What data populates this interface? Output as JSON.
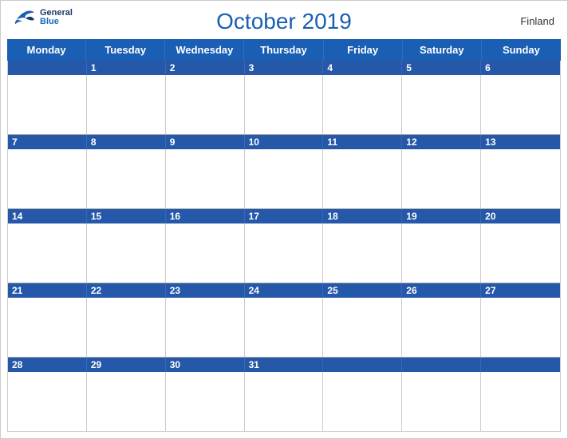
{
  "header": {
    "title": "October 2019",
    "country": "Finland",
    "logo": {
      "general": "General",
      "blue": "Blue"
    }
  },
  "dayHeaders": [
    "Monday",
    "Tuesday",
    "Wednesday",
    "Thursday",
    "Friday",
    "Saturday",
    "Sunday"
  ],
  "weeks": [
    {
      "numbers": [
        "",
        "1",
        "2",
        "3",
        "4",
        "5",
        "6"
      ]
    },
    {
      "numbers": [
        "7",
        "8",
        "9",
        "10",
        "11",
        "12",
        "13"
      ]
    },
    {
      "numbers": [
        "14",
        "15",
        "16",
        "17",
        "18",
        "19",
        "20"
      ]
    },
    {
      "numbers": [
        "21",
        "22",
        "23",
        "24",
        "25",
        "26",
        "27"
      ]
    },
    {
      "numbers": [
        "28",
        "29",
        "30",
        "31",
        "",
        "",
        ""
      ]
    }
  ],
  "colors": {
    "headerBlue": "#1a5fb4",
    "barBlue": "#2558a8",
    "darkBlue": "#1a3a6b"
  }
}
